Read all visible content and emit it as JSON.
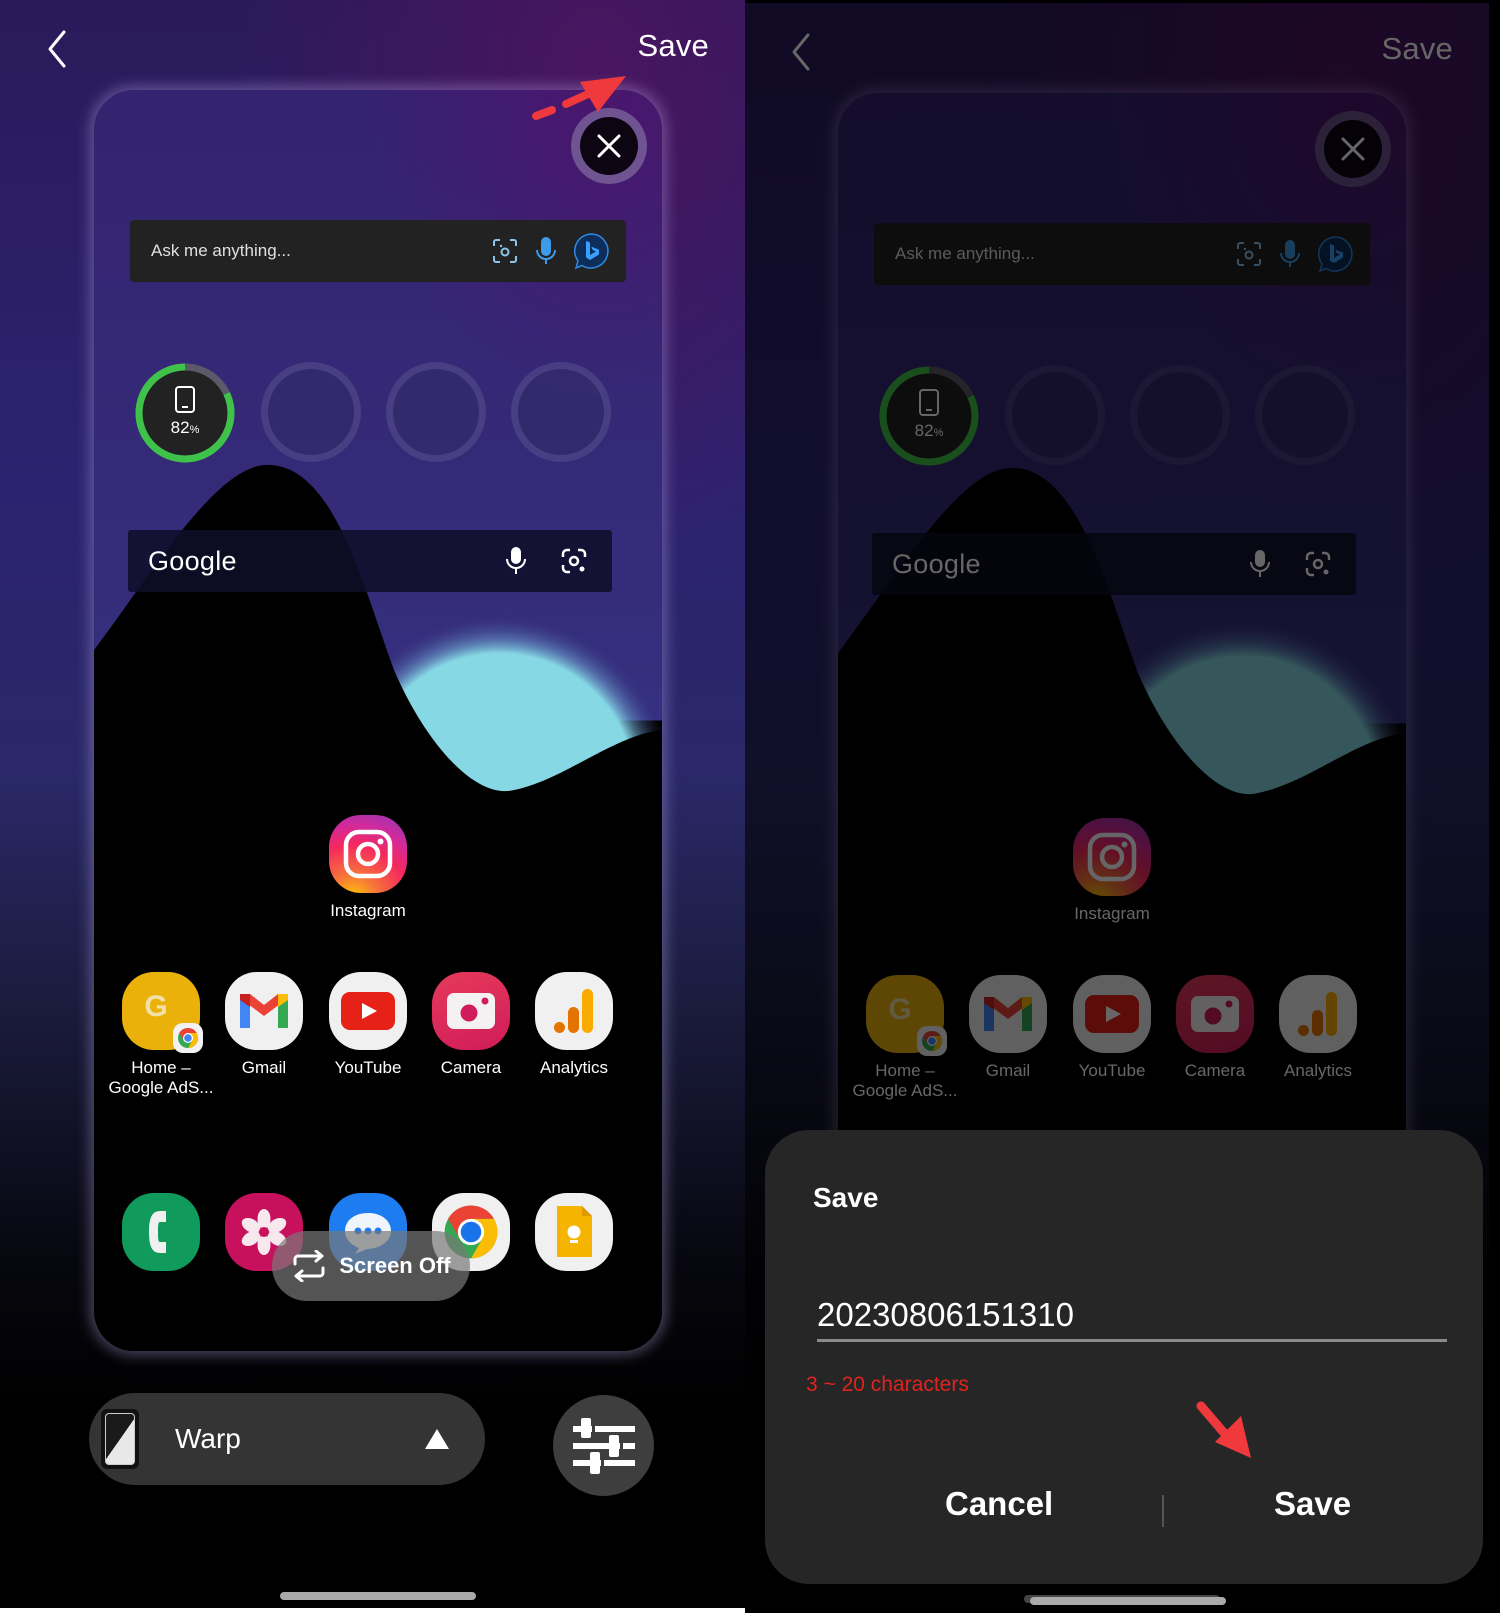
{
  "left_panel": {
    "top_bar": {
      "back_icon": "chevron-left-icon",
      "save_label": "Save"
    },
    "preview": {
      "close_icon": "close-icon",
      "ask_bar": {
        "placeholder": "Ask me anything...",
        "icons": [
          "visual-search-icon",
          "mic-icon",
          "bing-chat-icon"
        ]
      },
      "battery_widget": {
        "value_text": "82",
        "unit": "%",
        "level_percent": 82,
        "empty_slots": 3
      },
      "google_bar": {
        "logo_text": "Google",
        "icons": [
          "mic-icon",
          "google-lens-icon"
        ]
      },
      "apps_row1": [
        {
          "name": "Instagram",
          "icon": "instagram-icon"
        }
      ],
      "apps_row2": [
        {
          "name": "Home – Google AdS...",
          "icon": "google-ads-icon"
        },
        {
          "name": "Gmail",
          "icon": "gmail-icon"
        },
        {
          "name": "YouTube",
          "icon": "youtube-icon"
        },
        {
          "name": "Camera",
          "icon": "camera-icon"
        },
        {
          "name": "Analytics",
          "icon": "analytics-icon"
        }
      ],
      "dock": [
        {
          "name": "Phone",
          "icon": "phone-icon"
        },
        {
          "name": "Gallery",
          "icon": "gallery-icon"
        },
        {
          "name": "Messages",
          "icon": "messages-icon"
        },
        {
          "name": "Chrome",
          "icon": "chrome-icon"
        },
        {
          "name": "Keep Notes",
          "icon": "keep-icon"
        }
      ],
      "screen_off_label": "Screen Off"
    },
    "bottom_bar": {
      "effect_label": "Warp",
      "effect_arrow": "triangle-up-icon",
      "adjust_icon": "sliders-icon"
    }
  },
  "right_panel": {
    "dialog": {
      "title": "Save",
      "input_value": "20230806151310",
      "hint": "3 ~ 20 characters",
      "cancel_label": "Cancel",
      "save_label": "Save"
    }
  },
  "colors": {
    "battery_green": "#3fc24a",
    "hint_red": "#e0231e",
    "annotation_red": "#f0393c",
    "dialog_bg": "#262626",
    "pill_bg": "#343434"
  }
}
